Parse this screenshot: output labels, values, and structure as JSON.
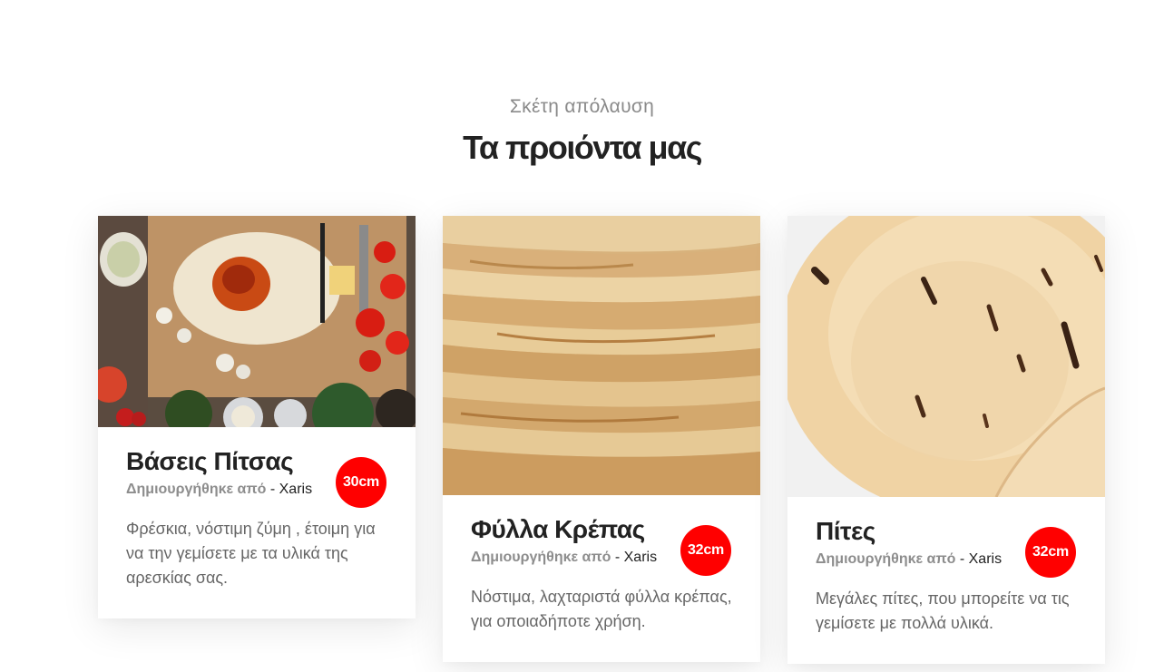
{
  "section": {
    "kicker": "Σκέτη απόλαυση",
    "title": "Τα προιόντα μας"
  },
  "products": [
    {
      "title": "Βάσεις Πίτσας",
      "by_label": "Δημιουργήθηκε από",
      "author": "- Xaris",
      "badge": "30cm",
      "description": "Φρέσκια, νόστιμη ζύμη , έτοιμη για να την γεμίσετε με τα υλικά της αρεσκίας σας.",
      "image": "pizza-dough-photo"
    },
    {
      "title": "Φύλλα Κρέπας",
      "by_label": "Δημιουργήθηκε από",
      "author": "- Xaris",
      "badge": "32cm",
      "description": "Νόστιμα, λαχταριστά φύλλα κρέπας, για οποιαδήποτε χρήση.",
      "image": "crepe-stack-photo"
    },
    {
      "title": "Πίτες",
      "by_label": "Δημιουργήθηκε από",
      "author": "- Xaris",
      "badge": "32cm",
      "description": "Μεγάλες πίτες, που μπορείτε να τις γεμίσετε με πολλά υλικά.",
      "image": "pita-bread-photo"
    }
  ],
  "colors": {
    "accent": "#ff0000",
    "title": "#222222",
    "muted": "#8a8a8a",
    "text": "#666666"
  }
}
